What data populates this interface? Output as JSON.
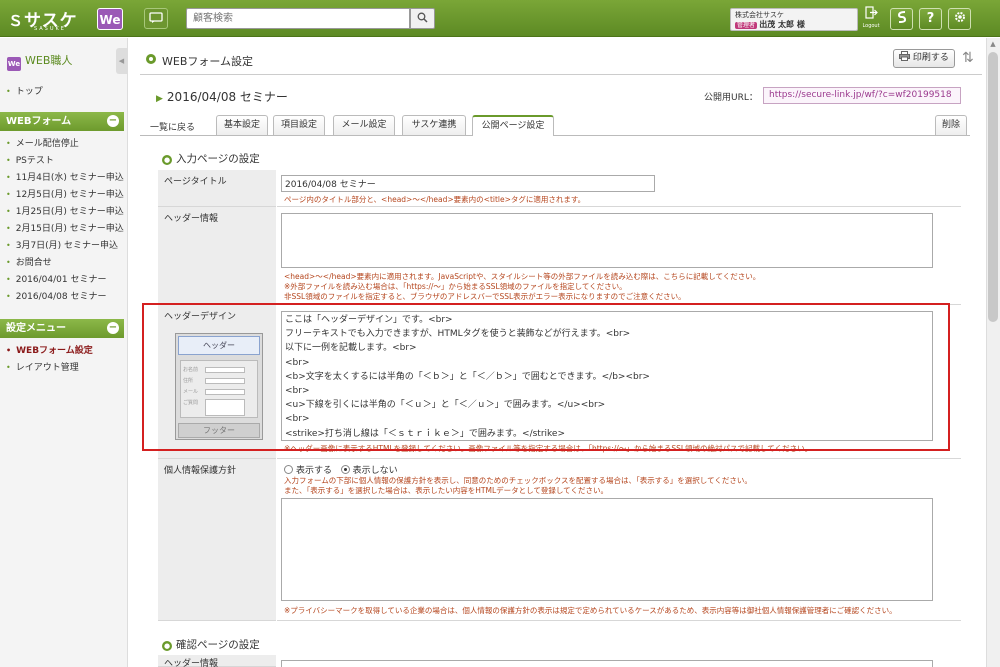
{
  "topbar": {
    "logo_text": "サスケ",
    "logo_sub": "SASUKE",
    "we_badge": "We",
    "chat_icon": "chat-icon",
    "search_placeholder": "顧客検索",
    "search_icon": "search-icon",
    "user_company": "株式会社サスケ",
    "user_role_badge": "管理者",
    "user_name": "出茂 太郎 様",
    "logout_label": "Logout",
    "icons": [
      "sasuke-icon",
      "help-icon",
      "gear-icon"
    ],
    "help_glyph": "?"
  },
  "sidebar": {
    "title": "WEB職人",
    "title_badge": "We",
    "top_link": "トップ",
    "section1_title": "WEBフォーム",
    "section1_items": [
      "メール配信停止",
      "PSテスト",
      "11月4日(水) セミナー申込",
      "12月5日(月) セミナー申込",
      "1月25日(月) セミナー申込",
      "2月15日(月) セミナー申込",
      "3月7日(月) セミナー申込",
      "お問合せ",
      "2016/04/01 セミナー",
      "2016/04/08 セミナー"
    ],
    "section2_title": "設定メニュー",
    "section2_items": [
      "WEBフォーム設定",
      "レイアウト管理"
    ]
  },
  "main": {
    "title": "WEBフォーム設定",
    "print_label": "印刷する",
    "form_title": "2016/04/08 セミナー",
    "url_label": "公開用URL：",
    "url_value": "https://secure-link.jp/wf/?c=wf20199518",
    "back_link": "一覧に戻る",
    "tabs": [
      "基本設定",
      "項目設定",
      "メール設定",
      "サスケ連携",
      "公開ページ設定"
    ],
    "delete_tab": "削除",
    "input_section": "入力ページの設定",
    "confirm_section": "確認ページの設定",
    "rows": {
      "page_title": {
        "label": "ページタイトル",
        "value": "2016/04/08 セミナー",
        "note": "ページ内のタイトル部分と、<head>〜</head>要素内の<title>タグに適用されます。"
      },
      "header_info": {
        "label": "ヘッダー情報",
        "notes": [
          "<head>〜</head>要素内に適用されます。JavaScriptや、スタイルシート等の外部ファイルを読み込む際は、こちらに記載してください。",
          "※外部ファイルを読み込む場合は、「https://〜」から始まるSSL領域のファイルを指定してください。",
          "非SSL領域のファイルを指定すると、ブラウザのアドレスバーでSSL表示がエラー表示になりますのでご注意ください。"
        ]
      },
      "header_design": {
        "label": "ヘッダーデザイン",
        "thumb_header": "ヘッダー",
        "thumb_footer": "フッター",
        "thumb_fields": [
          "お名前",
          "住所",
          "メール",
          "ご質問"
        ],
        "lines": [
          "ここは「ヘッダーデザイン」です。<br>",
          "フリーテキストでも入力できますが、HTMLタグを使うと装飾などが行えます。<br>",
          "以下に一例を記載します。<br>",
          "<br>",
          "<b>文字を太くするには半角の「＜ｂ＞」と「＜／ｂ＞」で囲むとできます。</b><br>",
          "<br>",
          "<u>下線を引くには半角の「＜ｕ＞」と「＜／ｕ＞」で囲みます。</u><br>",
          "<br>",
          "<strike>打ち消し線は「＜ｓｔｒｉｋｅ＞」で囲みます。</strike>"
        ],
        "note": "※ヘッダー画像に表示するHTMLを登録してください。画像ファイル等を指定する場合は、「https://〜」から始まるSSL領域の絶対パスで記載してください。"
      },
      "privacy": {
        "label": "個人情報保護方針",
        "option_show": "表示する",
        "option_hide": "表示しない",
        "notes": [
          "入力フォームの下部に個人情報の保護方針を表示し、同意のためのチェックボックスを配置する場合は、「表示する」を選択してください。",
          "また、「表示する」を選択した場合は、表示したい内容をHTMLデータとして登録してください。"
        ],
        "bottom_note": "※プライバシーマークを取得している企業の場合は、個人情報の保護方針の表示は規定で定められているケースがあるため、表示内容等は御社個人情報保護管理者にご確認ください。"
      },
      "confirm_header_info": {
        "label": "ヘッダー情報"
      }
    }
  },
  "colors": {
    "brand_green": "#6a9a2b",
    "note_orange": "#b5461e",
    "highlight_red": "#d42020",
    "url_purple": "#9b3a8e"
  }
}
